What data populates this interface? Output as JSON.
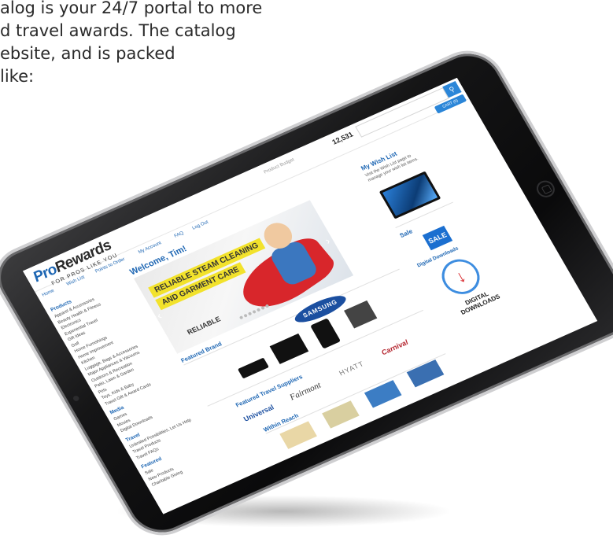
{
  "intro": {
    "line1": "alog is your 24/7 portal to more",
    "line2": "d travel awards. The catalog",
    "line3": "ebsite, and is packed",
    "line4": "like:"
  },
  "header": {
    "logo_pro": "Pro",
    "logo_rewards": "Rewards",
    "tagline": "FOR PROS LIKE YOU",
    "points_label": "Product Budget",
    "points_value": "12,531",
    "search_placeholder": "",
    "search_icon": "search-icon",
    "cart_label": "CART (0)"
  },
  "nav": {
    "items": [
      "Home",
      "Wish List",
      "Points to Order",
      "My Account",
      "FAQ",
      "Log Out"
    ]
  },
  "sidebar": {
    "products_header": "Products",
    "products": [
      "Apparel & Accessories",
      "Beauty Health & Fitness",
      "Electronics",
      "Experiential Travel",
      "Gift Ideas",
      "Golf",
      "Home Furnishings",
      "Home Improvement",
      "Kitchen",
      "Luggage, Bags & Accessories",
      "Major Appliances & Vacuums",
      "Outdoors & Recreation",
      "Patio, Lawn & Garden",
      "Pets",
      "Toys, Kids & Baby",
      "Travel Gift & Award Cards"
    ],
    "media_header": "Media",
    "media": [
      "Games",
      "Movies",
      "Digital Downloads"
    ],
    "travel_header": "Travel",
    "travel": [
      "Unlimited Possibilities, Let Us Help",
      "Travel Products",
      "Travel FAQs"
    ],
    "featured_header": "Featured",
    "featured": [
      "Sale",
      "New Products",
      "Charitable Giving"
    ]
  },
  "main": {
    "welcome": "Welcome, Tim!",
    "hero_line1": "RELIABLE STEAM CLEANING",
    "hero_line2": "AND GARMENT CARE",
    "hero_brand": "RELIABLE",
    "featured_brand_title": "Featured Brand",
    "brand_logo": "SAMSUNG",
    "featured_travel_title": "Featured Travel Suppliers",
    "suppliers": [
      "Universal",
      "Fairmont",
      "HYATT",
      "Carnival"
    ],
    "within_reach_title": "Within Reach"
  },
  "right": {
    "wish_title": "My Wish List",
    "wish_text": "Visit the Wish List page to manage your wish list items.",
    "sale_title": "Sale",
    "sale_badge": "SALE",
    "dl_title": "Digital Downloads",
    "dl_text1": "DIGITAL",
    "dl_text2": "DOWNLOADS"
  },
  "colors": {
    "brand_blue": "#1d66b3",
    "button_blue": "#2b86d8",
    "banner_yellow": "#f2e22c",
    "cape_red": "#d8262b"
  }
}
